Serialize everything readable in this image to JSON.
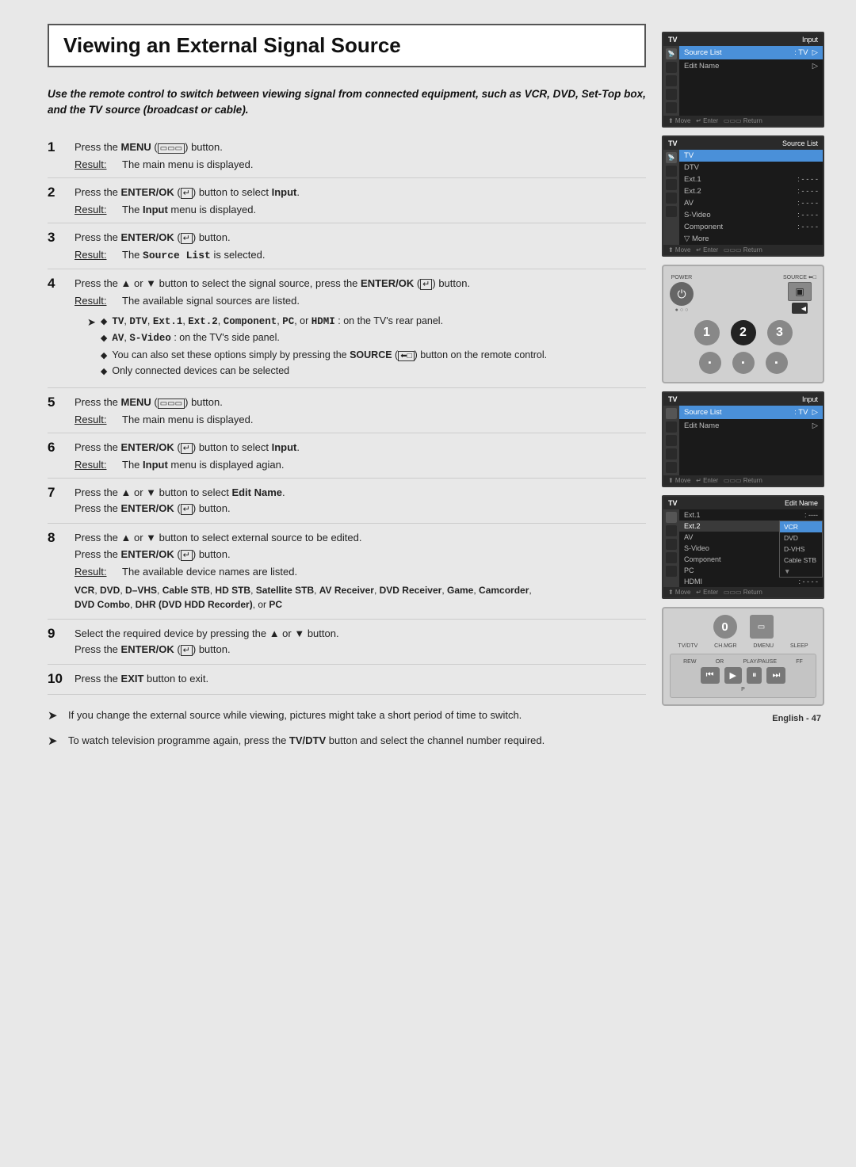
{
  "title": "Viewing an External Signal Source",
  "intro": "Use the remote control to switch between viewing signal from connected equipment, such as VCR, DVD, Set-Top box, and the TV source (broadcast or cable).",
  "steps": [
    {
      "num": "1",
      "instruction": "Press the MENU (□□□) button.",
      "result_label": "Result:",
      "result_text": "The main menu is displayed."
    },
    {
      "num": "2",
      "instruction": "Press the ENTER/OK (↵) button to select Input.",
      "result_label": "Result:",
      "result_text": "The Input menu is displayed."
    },
    {
      "num": "3",
      "instruction": "Press the ENTER/OK (↵) button.",
      "result_label": "Result:",
      "result_text": "The Source List is selected."
    },
    {
      "num": "4",
      "instruction": "Press the ▲ or ▼ button to select the signal source, press the ENTER/OK (↵) button.",
      "result_label": "Result:",
      "result_text": "The available signal sources are listed.",
      "notes": [
        "TV, DTV, Ext.1, Ext.2, Component, PC, or HDMI : on the TV's rear panel.",
        "AV, S-Video : on the TV's side panel.",
        "You can also set these options simply by pressing the SOURCE (←□) button on the remote control.",
        "Only connected devices can be selected"
      ]
    },
    {
      "num": "5",
      "instruction": "Press the MENU (□□□) button.",
      "result_label": "Result:",
      "result_text": "The main menu is displayed."
    },
    {
      "num": "6",
      "instruction": "Press the ENTER/OK (↵) button to select Input.",
      "result_label": "Result:",
      "result_text": "The Input menu is displayed again."
    },
    {
      "num": "7",
      "instruction": "Press the ▲ or ▼ button to select Edit Name. Press the ENTER/OK (↵) button.",
      "result_label": null
    },
    {
      "num": "8",
      "instruction": "Press the ▲ or ▼ button to select external source to be edited. Press the ENTER/OK (↵) button.",
      "result_label": "Result:",
      "result_text": "The available device names are listed.",
      "extra": "VCR, DVD, D-VHS, Cable STB, HD STB, Satellite STB, AV Receiver, DVD Receiver, Game, Camcorder, DVD Combo, DHR (DVD HDD Recorder), or PC"
    },
    {
      "num": "9",
      "instruction": "Select the required device by pressing the ▲ or ▼ button. Press the ENTER/OK (↵) button.",
      "result_label": null
    },
    {
      "num": "10",
      "instruction": "Press the EXIT button to exit.",
      "result_label": null
    }
  ],
  "tips": [
    "If you change the external source while viewing, pictures might take a short period of time to switch.",
    "To watch television programme again, press the TV/DTV button and select the channel number required."
  ],
  "footer": {
    "language": "English",
    "page": "47"
  },
  "screens": {
    "screen1": {
      "header_left": "TV",
      "header_right": "Input",
      "rows": [
        {
          "label": "Source List",
          "value": ": TV",
          "arrow": "▷",
          "highlight": true
        },
        {
          "label": "Edit Name",
          "value": "",
          "arrow": "▷",
          "highlight": false
        }
      ],
      "footer": "⬆ Move  ↵ Enter  □ Return"
    },
    "screen2": {
      "header_left": "TV",
      "header_right": "Source List",
      "rows": [
        {
          "label": "TV",
          "value": "",
          "highlight": true
        },
        {
          "label": "DTV",
          "value": "",
          "highlight": false
        },
        {
          "label": "Ext.1",
          "value": ": - - - -",
          "highlight": false
        },
        {
          "label": "Ext.2",
          "value": ": - - - -",
          "highlight": false
        },
        {
          "label": "AV",
          "value": ": - - - -",
          "highlight": false
        },
        {
          "label": "S-Video",
          "value": ": - - - -",
          "highlight": false
        },
        {
          "label": "Component",
          "value": ": - - - -",
          "highlight": false
        },
        {
          "label": "▽ More",
          "value": "",
          "highlight": false
        }
      ],
      "footer": "⬆ Move  ↵ Enter  □ Return"
    },
    "screen3": {
      "type": "remote",
      "power_label": "POWER",
      "source_label": "SOURCE⬅□",
      "nums": [
        "1",
        "2",
        "3"
      ],
      "highlight_num": "2"
    },
    "screen4": {
      "header_left": "TV",
      "header_right": "Input",
      "rows": [
        {
          "label": "Source List",
          "value": ": TV",
          "arrow": "▷",
          "highlight": true
        },
        {
          "label": "Edit Name",
          "value": "",
          "arrow": "▷",
          "highlight": false
        }
      ],
      "footer": "⬆ Move  ↵ Enter  □ Return"
    },
    "screen5": {
      "header_left": "TV",
      "header_right": "Edit Name",
      "rows": [
        {
          "label": "Ext.1",
          "value": ": ----",
          "popup": null
        },
        {
          "label": "Ext.2",
          "value": ":",
          "popup": "VCR",
          "popup_highlight": true
        },
        {
          "label": "AV",
          "value": ":",
          "popup": "DVD",
          "popup_highlight": false
        },
        {
          "label": "S-Video",
          "value": ":",
          "popup": "D-VHS",
          "popup_highlight": false
        },
        {
          "label": "Component",
          "value": ":",
          "popup": "Cable STB",
          "popup_highlight": false
        },
        {
          "label": "PC",
          "value": ": ----",
          "popup": null
        },
        {
          "label": "HDMI",
          "value": ": - - - -",
          "popup": null
        }
      ],
      "footer": "⬆ Move  ↵ Enter  □ Return"
    },
    "screen6": {
      "type": "remote_bottom",
      "zero_btn": "0",
      "labels": [
        "TV/DTV",
        "CH.MGR",
        "DMENU",
        "SLEEP"
      ],
      "media_btns": [
        "◀◀",
        "▶",
        "▶||",
        "▶▶"
      ],
      "media_labels": [
        "REW",
        "OR",
        "PLAY/PAUSE",
        "FF"
      ]
    }
  }
}
